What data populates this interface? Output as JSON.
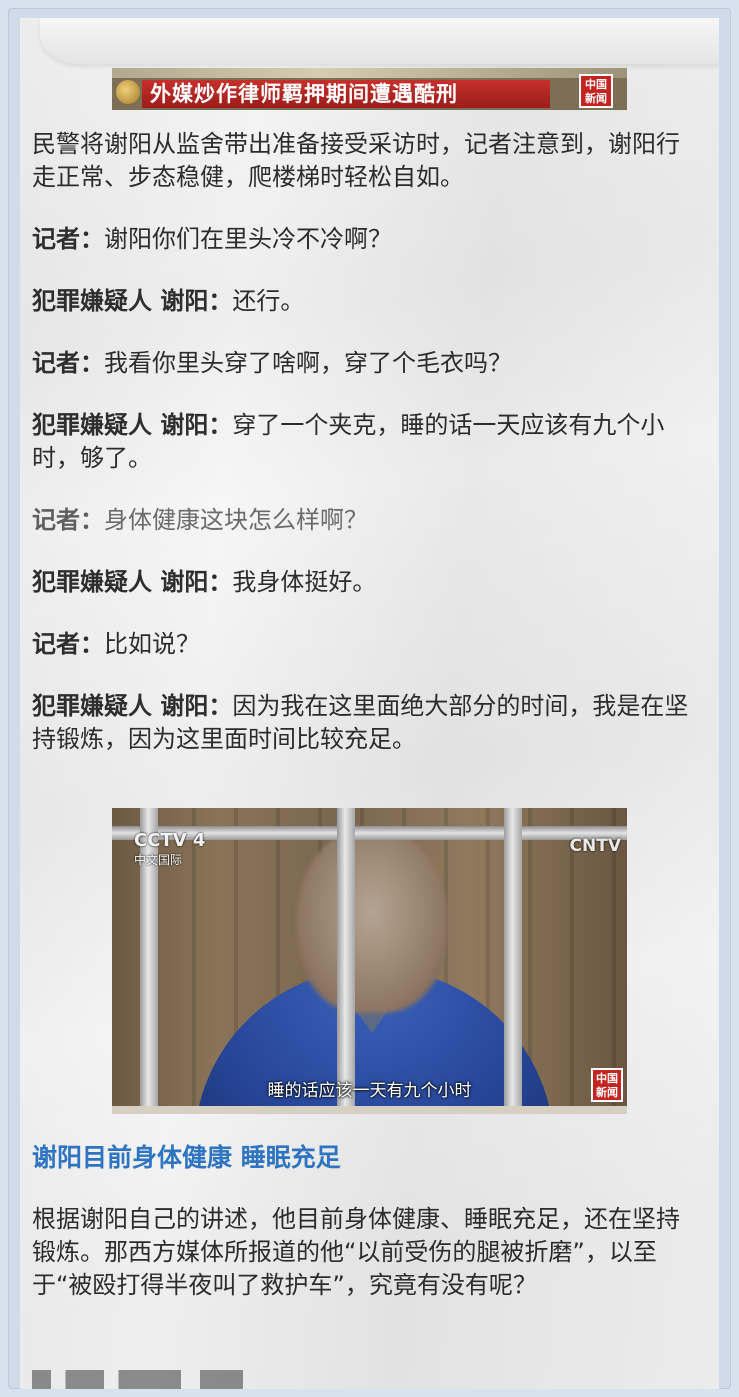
{
  "banner": {
    "headline": "外媒炒作律师羁押期间遭遇酷刑",
    "logo": "中国新闻"
  },
  "intro": "民警将谢阳从监舍带出准备接受采访时，记者注意到，谢阳行走正常、步态稳健，爬楼梯时轻松自如。",
  "dialogue": [
    {
      "speaker": "记者：",
      "text": "谢阳你们在里头冷不冷啊？"
    },
    {
      "speaker": "犯罪嫌疑人 谢阳：",
      "text": "还行。"
    },
    {
      "speaker": "记者：",
      "text": "我看你里头穿了啥啊，穿了个毛衣吗？"
    },
    {
      "speaker": "犯罪嫌疑人 谢阳：",
      "text": "穿了一个夹克，睡的话一天应该有九个小时，够了。"
    },
    {
      "speaker": "记者：",
      "text": "身体健康这块怎么样啊？"
    },
    {
      "speaker": "犯罪嫌疑人 谢阳：",
      "text": "我身体挺好。"
    },
    {
      "speaker": "记者：",
      "text": "比如说？"
    },
    {
      "speaker": "犯罪嫌疑人 谢阳：",
      "text": "因为我在这里面绝大部分的时间，我是在坚持锻炼，因为这里面时间比较充足。"
    }
  ],
  "photo": {
    "channel_left": "CCTV 4",
    "channel_left_sub": "中文国际",
    "channel_right": "CNTV",
    "subtitle": "睡的话应该一天有九个小时",
    "logo": "中国新闻"
  },
  "section_heading": "谢阳目前身体健康 睡眠充足",
  "paragraph": "根据谢阳自己的讲述，他目前身体健康、睡眠充足，还在坚持锻炼。那西方媒体所报道的他“以前受伤的腿被折磨”，以至于“被殴打得半夜叫了救护车”，究竟有没有呢？"
}
